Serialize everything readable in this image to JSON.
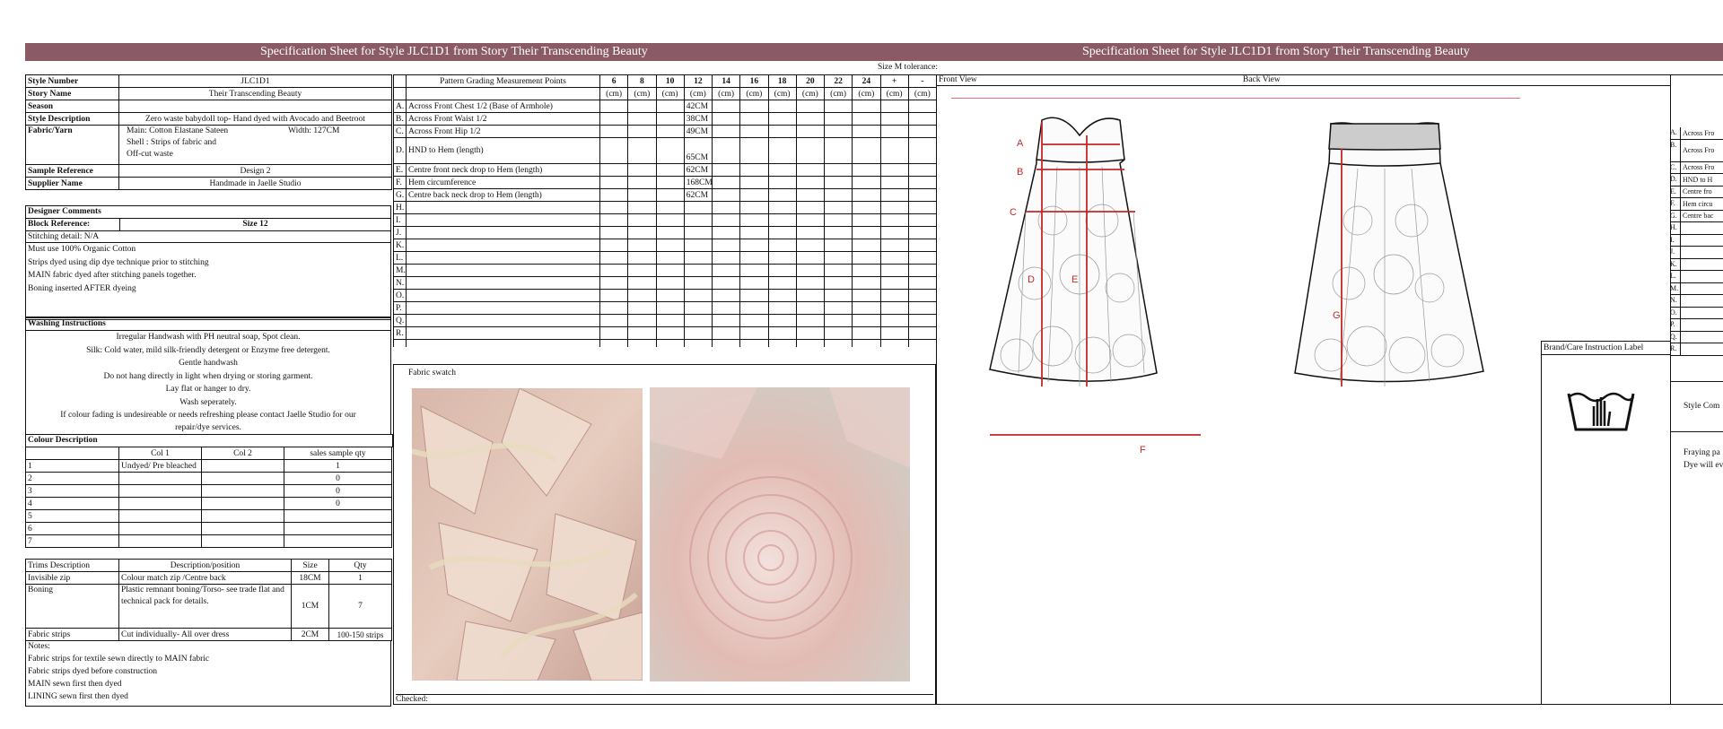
{
  "banner": {
    "title_left": "Specification Sheet for Style JLC1D1 from Story Their Transcending Beauty",
    "title_right": "Specification Sheet for Style JLC1D1 from Story Their Transcending Beauty"
  },
  "tolerance": "Size M tolerance:",
  "style_info": [
    {
      "label": "Style Number",
      "value": "JLC1D1"
    },
    {
      "label": "Story Name",
      "value": "Their Transcending Beauty"
    },
    {
      "label": "Season",
      "value": ""
    },
    {
      "label": "Style Description",
      "value": "Zero waste babydoll top- Hand dyed with Avocado and Beetroot"
    }
  ],
  "fabric": {
    "label": "Fabric/Yarn",
    "main": "Main: Cotton Elastane Sateen",
    "width": "Width: 127CM",
    "shell": "Shell : Strips of fabric and",
    "offcut": "Off-cut waste"
  },
  "sample": [
    {
      "label": "Sample Reference",
      "value": "Design 2"
    },
    {
      "label": "Supplier Name",
      "value": "Handmade in Jaelle Studio"
    }
  ],
  "designer": {
    "heading": "Designer Comments",
    "block_label": "Block Reference:",
    "block_value": "Size 12",
    "stitching": "Stitching detail: N/A",
    "lines": [
      "Must use 100% Organic Cotton",
      "Strips dyed using dip dye technique prior to stitching",
      "MAIN fabric dyed after stitching panels together.",
      "Boning inserted AFTER dyeing"
    ]
  },
  "washing": {
    "heading": "Washing Instructions",
    "lines": [
      "Irregular Handwash with PH neutral soap, Spot clean.",
      "Silk: Cold water, mild silk-friendly detergent or Enzyme free detergent.",
      "Gentle handwash",
      "Do not hang directly in light when drying or storing garment.",
      "Lay flat or hanger to dry.",
      "Wash seperately.",
      "If colour fading is undesireable or needs refreshing please contact Jaelle Studio for our",
      "repair/dye services."
    ]
  },
  "colour": {
    "heading": "Colour Description",
    "headers": [
      "",
      "Col 1",
      "Col 2",
      "sales sample qty"
    ],
    "rows": [
      [
        "1",
        "Undyed/ Pre bleached",
        "",
        "1"
      ],
      [
        "2",
        "",
        "",
        "0"
      ],
      [
        "3",
        "",
        "",
        "0"
      ],
      [
        "4",
        "",
        "",
        "0"
      ],
      [
        "5",
        "",
        "",
        ""
      ],
      [
        "6",
        "",
        "",
        ""
      ],
      [
        "7",
        "",
        "",
        ""
      ]
    ]
  },
  "trims": {
    "headers": [
      "Trims Description",
      "Description/position",
      "Size",
      "Qty"
    ],
    "rows": [
      {
        "name": "Invisible zip",
        "desc": "Colour match zip /Centre back",
        "size": "18CM",
        "qty": "1"
      },
      {
        "name": "Boning",
        "desc": "Plastic remnant boning/Torso- see trade flat and technical pack for details.",
        "size": "1CM",
        "qty": "7"
      },
      {
        "name": "Fabric strips",
        "desc": "Cut individually- All over dress",
        "size": "2CM",
        "qty": "100-150 strips"
      }
    ]
  },
  "notes": {
    "heading": "Notes:",
    "lines": [
      "Fabric strips for textile sewn directly to MAIN fabric",
      "Fabric strips dyed before construction",
      "MAIN sewn first then dyed",
      "LINING sewn first then dyed"
    ]
  },
  "grading": {
    "heading": "Pattern Grading Measurement Points",
    "sizes": [
      "6",
      "8",
      "10",
      "12",
      "14",
      "16",
      "18",
      "20",
      "22",
      "24",
      "+",
      "-"
    ],
    "units": [
      "(cm)",
      "(cm)",
      "(cm)",
      "(cm)",
      "(cm)",
      "(cm)",
      "(cm)",
      "(cm)",
      "(cm)",
      "(cm)",
      "(cm)",
      "(cm)"
    ],
    "rows": [
      {
        "letter": "A.",
        "point": "Across Front Chest 1/2 (Base of Armhole)",
        "size12": "42CM"
      },
      {
        "letter": "B.",
        "point": "Across Front Waist 1/2",
        "size12": "38CM"
      },
      {
        "letter": "C.",
        "point": "Across Front Hip 1/2",
        "size12": "49CM"
      },
      {
        "letter": "D.",
        "point": "HND to Hem (length)",
        "size12": "65CM"
      },
      {
        "letter": "E.",
        "point": "Centre front neck drop to Hem (length)",
        "size12": "62CM"
      },
      {
        "letter": "F.",
        "point": "Hem circumference",
        "size12": "168CM"
      },
      {
        "letter": "G.",
        "point": "Centre back neck drop to Hem (length)",
        "size12": "62CM"
      },
      {
        "letter": "H.",
        "point": "",
        "size12": ""
      },
      {
        "letter": "I.",
        "point": "",
        "size12": ""
      },
      {
        "letter": "J.",
        "point": "",
        "size12": ""
      },
      {
        "letter": "K.",
        "point": "",
        "size12": ""
      },
      {
        "letter": "L.",
        "point": "",
        "size12": ""
      },
      {
        "letter": "M.",
        "point": "",
        "size12": ""
      },
      {
        "letter": "N.",
        "point": "",
        "size12": ""
      },
      {
        "letter": "O.",
        "point": "",
        "size12": ""
      },
      {
        "letter": "P.",
        "point": "",
        "size12": ""
      },
      {
        "letter": "Q.",
        "point": "",
        "size12": ""
      },
      {
        "letter": "R.",
        "point": "",
        "size12": ""
      }
    ]
  },
  "swatch": {
    "label": "Fabric swatch",
    "checked": "Checked:"
  },
  "views": {
    "front": "Front View",
    "back": "Back View",
    "labels": [
      "A",
      "B",
      "C",
      "D",
      "E",
      "F",
      "G"
    ]
  },
  "care": {
    "label": "Brand/Care Instruction Label",
    "icon": "handwash-icon"
  },
  "right_panel": {
    "rows": [
      {
        "letter": "A.",
        "text": "Across Fro"
      },
      {
        "letter": "B.",
        "text": "Across Fro"
      },
      {
        "letter": "C.",
        "text": "Across Fro"
      },
      {
        "letter": "D.",
        "text": "HND to H"
      },
      {
        "letter": "E.",
        "text": "Centre fro"
      },
      {
        "letter": "F.",
        "text": "Hem circu"
      },
      {
        "letter": "G.",
        "text": "Centre bac"
      },
      {
        "letter": "H.",
        "text": ""
      },
      {
        "letter": "I.",
        "text": ""
      },
      {
        "letter": "J.",
        "text": ""
      },
      {
        "letter": "K.",
        "text": ""
      },
      {
        "letter": "L.",
        "text": ""
      },
      {
        "letter": "M.",
        "text": ""
      },
      {
        "letter": "N.",
        "text": ""
      },
      {
        "letter": "O.",
        "text": ""
      },
      {
        "letter": "P.",
        "text": ""
      },
      {
        "letter": "Q.",
        "text": ""
      },
      {
        "letter": "R.",
        "text": ""
      }
    ],
    "style_comments": "Style Com",
    "note1": "Fraying pa",
    "note2": "Dye will ev"
  },
  "colors": {
    "banner": "#8a5a66",
    "measure_red": "#c62828"
  }
}
